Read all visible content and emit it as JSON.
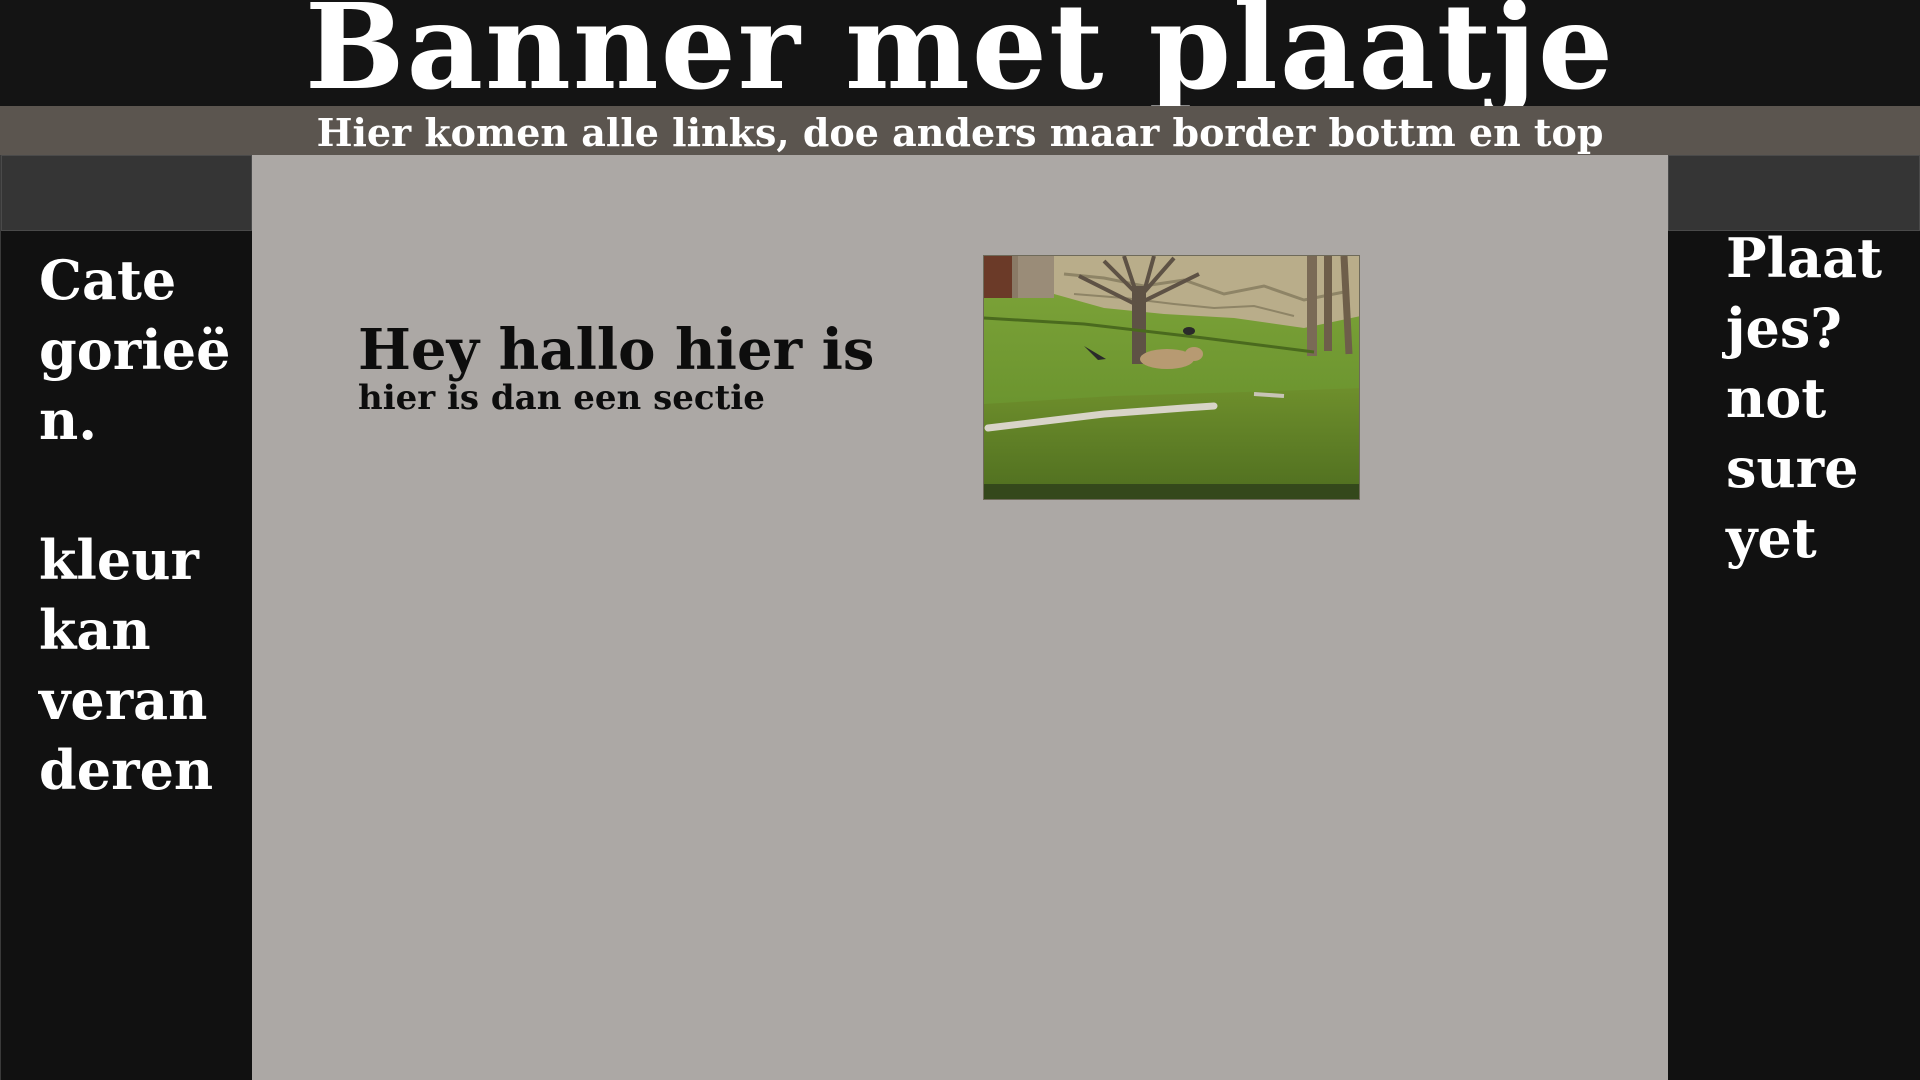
{
  "banner": {
    "title": "Banner met plaatje"
  },
  "nav": {
    "text": "Hier komen alle links, doe anders maar border bottm en top"
  },
  "left_sidebar": {
    "lines_1": [
      "Cate",
      "gorieë",
      "n."
    ],
    "lines_2": [
      "kleur",
      "kan",
      "veran",
      "deren"
    ]
  },
  "right_sidebar": {
    "lines": [
      "Plaat",
      "jes?",
      "not",
      "sure",
      "yet"
    ]
  },
  "main": {
    "heading": "Hey hallo hier is",
    "subheading": "hier is dan een sectie"
  },
  "colors": {
    "banner_bg": "#141414",
    "nav_bg": "#5b554f",
    "sidebar_bg": "#111111",
    "sidebar_header_bg": "#353535",
    "main_bg": "#aca8a5"
  }
}
